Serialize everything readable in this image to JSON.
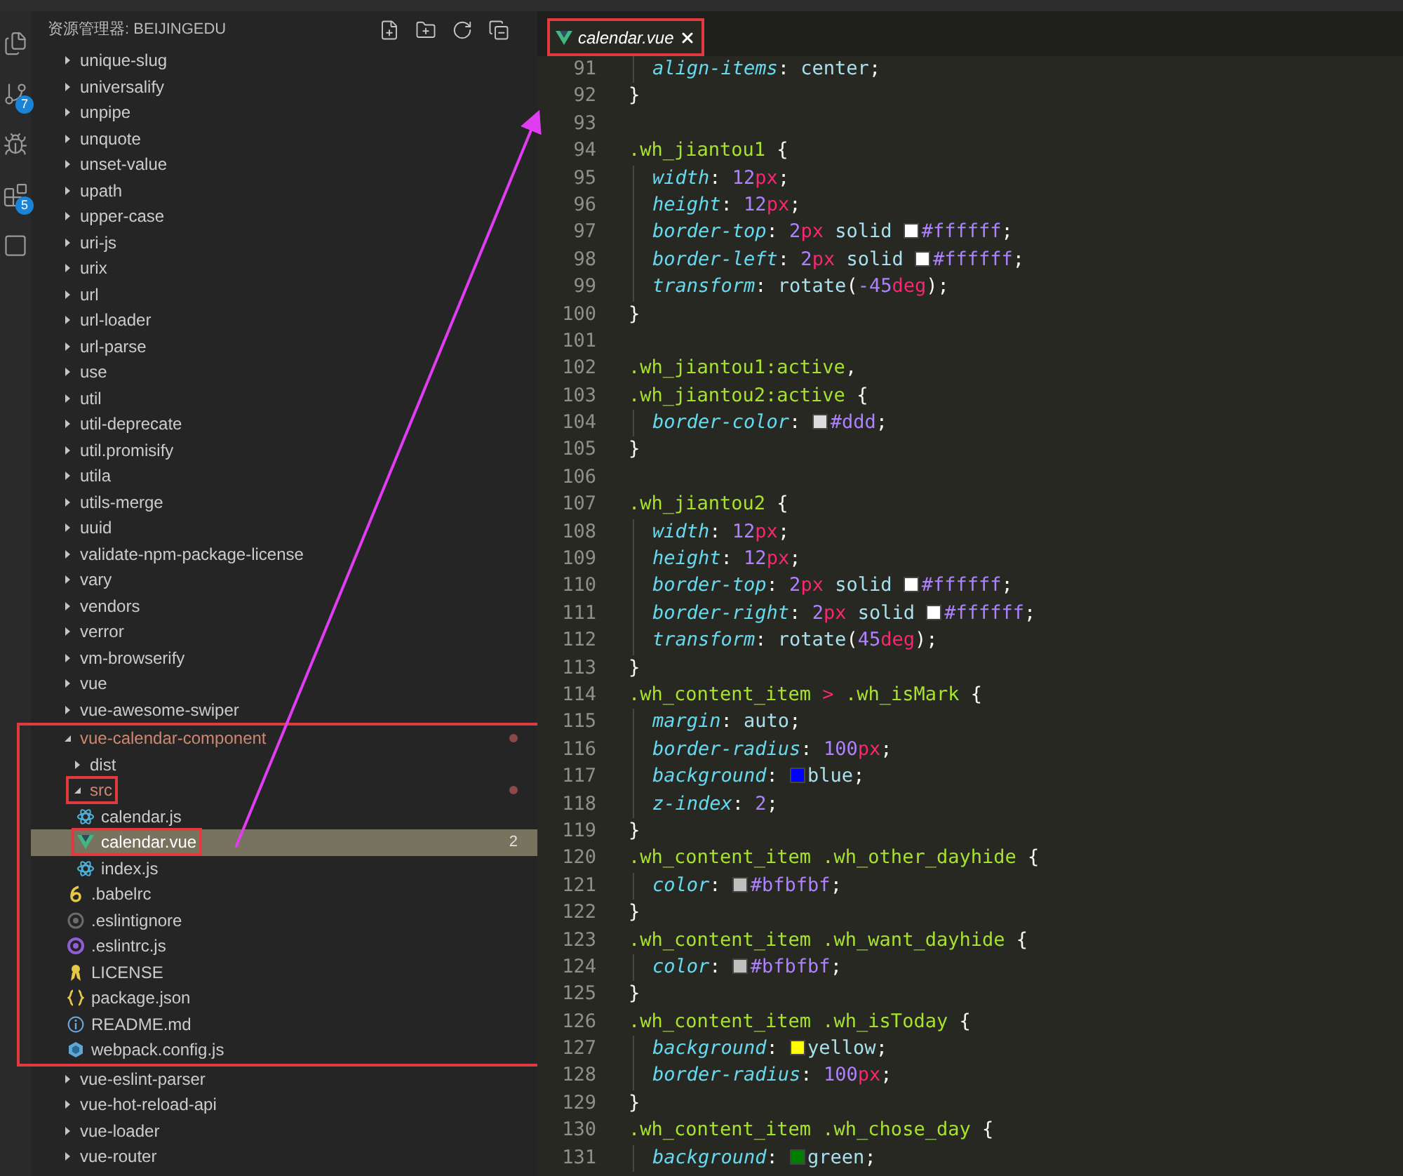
{
  "activity_bar": {
    "items": [
      {
        "kind": "files"
      },
      {
        "kind": "git",
        "badge": "7"
      },
      {
        "kind": "debug"
      },
      {
        "kind": "extensions",
        "badge": "5"
      },
      {
        "kind": "box"
      }
    ]
  },
  "sidebar": {
    "title": "资源管理器: BEIJINGEDU",
    "items": [
      {
        "label": "unique-slug",
        "kind": "folder",
        "expanded": false,
        "selected": false,
        "modified": false
      },
      {
        "label": "universalify",
        "kind": "folder",
        "expanded": false,
        "selected": false,
        "modified": false
      },
      {
        "label": "unpipe",
        "kind": "folder",
        "expanded": false,
        "selected": false,
        "modified": false
      },
      {
        "label": "unquote",
        "kind": "folder",
        "expanded": false,
        "selected": false,
        "modified": false
      },
      {
        "label": "unset-value",
        "kind": "folder",
        "expanded": false,
        "selected": false,
        "modified": false
      },
      {
        "label": "upath",
        "kind": "folder",
        "expanded": false,
        "selected": false,
        "modified": false
      },
      {
        "label": "upper-case",
        "kind": "folder",
        "expanded": false,
        "selected": false,
        "modified": false
      },
      {
        "label": "uri-js",
        "kind": "folder",
        "expanded": false,
        "selected": false,
        "modified": false
      },
      {
        "label": "urix",
        "kind": "folder",
        "expanded": false,
        "selected": false,
        "modified": false
      },
      {
        "label": "url",
        "kind": "folder",
        "expanded": false,
        "selected": false,
        "modified": false
      },
      {
        "label": "url-loader",
        "kind": "folder",
        "expanded": false,
        "selected": false,
        "modified": false
      },
      {
        "label": "url-parse",
        "kind": "folder",
        "expanded": false,
        "selected": false,
        "modified": false
      },
      {
        "label": "use",
        "kind": "folder",
        "expanded": false,
        "selected": false,
        "modified": false
      },
      {
        "label": "util",
        "kind": "folder",
        "expanded": false,
        "selected": false,
        "modified": false
      },
      {
        "label": "util-deprecate",
        "kind": "folder",
        "expanded": false,
        "selected": false,
        "modified": false
      },
      {
        "label": "util.promisify",
        "kind": "folder",
        "expanded": false,
        "selected": false,
        "modified": false
      },
      {
        "label": "utila",
        "kind": "folder",
        "expanded": false,
        "selected": false,
        "modified": false
      },
      {
        "label": "utils-merge",
        "kind": "folder",
        "expanded": false,
        "selected": false,
        "modified": false
      },
      {
        "label": "uuid",
        "kind": "folder",
        "expanded": false,
        "selected": false,
        "modified": false
      },
      {
        "label": "validate-npm-package-license",
        "kind": "folder",
        "expanded": false,
        "selected": false,
        "modified": false
      },
      {
        "label": "vary",
        "kind": "folder",
        "expanded": false,
        "selected": false,
        "modified": false
      },
      {
        "label": "vendors",
        "kind": "folder",
        "expanded": false,
        "selected": false,
        "modified": false
      },
      {
        "label": "verror",
        "kind": "folder",
        "expanded": false,
        "selected": false,
        "modified": false
      },
      {
        "label": "vm-browserify",
        "kind": "folder",
        "expanded": false,
        "selected": false,
        "modified": false
      },
      {
        "label": "vue",
        "kind": "folder",
        "expanded": false,
        "selected": false,
        "modified": false
      },
      {
        "label": "vue-awesome-swiper",
        "kind": "folder",
        "expanded": false,
        "selected": false,
        "modified": false
      },
      {
        "label": "vue-calendar-component",
        "kind": "folder",
        "expanded": true,
        "selected": false,
        "modified": true,
        "group_highlighted": true,
        "children": [
          {
            "label": "dist",
            "kind": "folder",
            "expanded": false,
            "selected": false,
            "modified": false
          },
          {
            "label": "src",
            "kind": "folder",
            "expanded": true,
            "selected": false,
            "modified": true,
            "highlighted": true,
            "children": [
              {
                "label": "calendar.js",
                "kind": "react",
                "selected": false,
                "modified": false
              },
              {
                "label": "calendar.vue",
                "kind": "vue",
                "selected": true,
                "modified": false,
                "highlighted": true,
                "badge": "2"
              },
              {
                "label": "index.js",
                "kind": "react",
                "selected": false,
                "modified": false
              }
            ]
          },
          {
            "label": ".babelrc",
            "kind": "babel",
            "selected": false,
            "modified": false
          },
          {
            "label": ".eslintignore",
            "kind": "ignore",
            "selected": false,
            "modified": false
          },
          {
            "label": ".eslintrc.js",
            "kind": "eslint",
            "selected": false,
            "modified": false
          },
          {
            "label": "LICENSE",
            "kind": "license",
            "selected": false,
            "modified": false
          },
          {
            "label": "package.json",
            "kind": "json",
            "selected": false,
            "modified": false
          },
          {
            "label": "README.md",
            "kind": "info",
            "selected": false,
            "modified": false
          },
          {
            "label": "webpack.config.js",
            "kind": "webpack",
            "selected": false,
            "modified": false
          }
        ]
      },
      {
        "label": "vue-eslint-parser",
        "kind": "folder",
        "expanded": false,
        "selected": false,
        "modified": false
      },
      {
        "label": "vue-hot-reload-api",
        "kind": "folder",
        "expanded": false,
        "selected": false,
        "modified": false
      },
      {
        "label": "vue-loader",
        "kind": "folder",
        "expanded": false,
        "selected": false,
        "modified": false
      },
      {
        "label": "vue-router",
        "kind": "folder",
        "expanded": false,
        "selected": false,
        "modified": false
      }
    ]
  },
  "tabs": [
    {
      "label": "calendar.vue",
      "kind": "vue",
      "selected": true,
      "highlighted": true
    }
  ],
  "editor": {
    "lines": [
      {
        "number": "91",
        "indented": true,
        "tokens": [
          {
            "kind": "prop",
            "text": "align-items"
          },
          {
            "kind": "punct",
            "text": ": "
          },
          {
            "kind": "val",
            "text": "center"
          },
          {
            "kind": "punct",
            "text": ";"
          }
        ]
      },
      {
        "number": "92",
        "indented": false,
        "tokens": [
          {
            "kind": "punct",
            "text": "}"
          }
        ]
      },
      {
        "number": "93",
        "indented": false
      },
      {
        "number": "94",
        "indented": false,
        "tokens": [
          {
            "kind": "sel",
            "text": ".wh_jiantou1"
          },
          {
            "kind": "punct",
            "text": " {"
          }
        ]
      },
      {
        "number": "95",
        "indented": true,
        "tokens": [
          {
            "kind": "prop",
            "text": "width"
          },
          {
            "kind": "punct",
            "text": ": "
          },
          {
            "kind": "num",
            "text": "12"
          },
          {
            "kind": "unit",
            "text": "px"
          },
          {
            "kind": "punct",
            "text": ";"
          }
        ]
      },
      {
        "number": "96",
        "indented": true,
        "tokens": [
          {
            "kind": "prop",
            "text": "height"
          },
          {
            "kind": "punct",
            "text": ": "
          },
          {
            "kind": "num",
            "text": "12"
          },
          {
            "kind": "unit",
            "text": "px"
          },
          {
            "kind": "punct",
            "text": ";"
          }
        ]
      },
      {
        "number": "97",
        "indented": true,
        "tokens": [
          {
            "kind": "prop",
            "text": "border-top"
          },
          {
            "kind": "punct",
            "text": ": "
          },
          {
            "kind": "num",
            "text": "2"
          },
          {
            "kind": "unit",
            "text": "px"
          },
          {
            "kind": "val",
            "text": " solid "
          },
          {
            "kind": "swatch",
            "color": "#ffffff"
          },
          {
            "kind": "hex",
            "text": "#ffffff"
          },
          {
            "kind": "punct",
            "text": ";"
          }
        ]
      },
      {
        "number": "98",
        "indented": true,
        "tokens": [
          {
            "kind": "prop",
            "text": "border-left"
          },
          {
            "kind": "punct",
            "text": ": "
          },
          {
            "kind": "num",
            "text": "2"
          },
          {
            "kind": "unit",
            "text": "px"
          },
          {
            "kind": "val",
            "text": " solid "
          },
          {
            "kind": "swatch",
            "color": "#ffffff"
          },
          {
            "kind": "hex",
            "text": "#ffffff"
          },
          {
            "kind": "punct",
            "text": ";"
          }
        ]
      },
      {
        "number": "99",
        "indented": true,
        "tokens": [
          {
            "kind": "prop",
            "text": "transform"
          },
          {
            "kind": "punct",
            "text": ": "
          },
          {
            "kind": "val",
            "text": "rotate"
          },
          {
            "kind": "punct",
            "text": "("
          },
          {
            "kind": "num",
            "text": "-45"
          },
          {
            "kind": "unit",
            "text": "deg"
          },
          {
            "kind": "punct",
            "text": ");"
          }
        ]
      },
      {
        "number": "100",
        "indented": false,
        "tokens": [
          {
            "kind": "punct",
            "text": "}"
          }
        ]
      },
      {
        "number": "101",
        "indented": false
      },
      {
        "number": "102",
        "indented": false,
        "tokens": [
          {
            "kind": "sel",
            "text": ".wh_jiantou1:active"
          },
          {
            "kind": "punct",
            "text": ","
          }
        ]
      },
      {
        "number": "103",
        "indented": false,
        "tokens": [
          {
            "kind": "sel",
            "text": ".wh_jiantou2:active"
          },
          {
            "kind": "punct",
            "text": " {"
          }
        ]
      },
      {
        "number": "104",
        "indented": true,
        "tokens": [
          {
            "kind": "prop",
            "text": "border-color"
          },
          {
            "kind": "punct",
            "text": ": "
          },
          {
            "kind": "swatch",
            "color": "#dddddd"
          },
          {
            "kind": "hex",
            "text": "#ddd"
          },
          {
            "kind": "punct",
            "text": ";"
          }
        ]
      },
      {
        "number": "105",
        "indented": false,
        "tokens": [
          {
            "kind": "punct",
            "text": "}"
          }
        ]
      },
      {
        "number": "106",
        "indented": false
      },
      {
        "number": "107",
        "indented": false,
        "tokens": [
          {
            "kind": "sel",
            "text": ".wh_jiantou2"
          },
          {
            "kind": "punct",
            "text": " {"
          }
        ]
      },
      {
        "number": "108",
        "indented": true,
        "tokens": [
          {
            "kind": "prop",
            "text": "width"
          },
          {
            "kind": "punct",
            "text": ": "
          },
          {
            "kind": "num",
            "text": "12"
          },
          {
            "kind": "unit",
            "text": "px"
          },
          {
            "kind": "punct",
            "text": ";"
          }
        ]
      },
      {
        "number": "109",
        "indented": true,
        "tokens": [
          {
            "kind": "prop",
            "text": "height"
          },
          {
            "kind": "punct",
            "text": ": "
          },
          {
            "kind": "num",
            "text": "12"
          },
          {
            "kind": "unit",
            "text": "px"
          },
          {
            "kind": "punct",
            "text": ";"
          }
        ]
      },
      {
        "number": "110",
        "indented": true,
        "tokens": [
          {
            "kind": "prop",
            "text": "border-top"
          },
          {
            "kind": "punct",
            "text": ": "
          },
          {
            "kind": "num",
            "text": "2"
          },
          {
            "kind": "unit",
            "text": "px"
          },
          {
            "kind": "val",
            "text": " solid "
          },
          {
            "kind": "swatch",
            "color": "#ffffff"
          },
          {
            "kind": "hex",
            "text": "#ffffff"
          },
          {
            "kind": "punct",
            "text": ";"
          }
        ]
      },
      {
        "number": "111",
        "indented": true,
        "tokens": [
          {
            "kind": "prop",
            "text": "border-right"
          },
          {
            "kind": "punct",
            "text": ": "
          },
          {
            "kind": "num",
            "text": "2"
          },
          {
            "kind": "unit",
            "text": "px"
          },
          {
            "kind": "val",
            "text": " solid "
          },
          {
            "kind": "swatch",
            "color": "#ffffff"
          },
          {
            "kind": "hex",
            "text": "#ffffff"
          },
          {
            "kind": "punct",
            "text": ";"
          }
        ]
      },
      {
        "number": "112",
        "indented": true,
        "tokens": [
          {
            "kind": "prop",
            "text": "transform"
          },
          {
            "kind": "punct",
            "text": ": "
          },
          {
            "kind": "val",
            "text": "rotate"
          },
          {
            "kind": "punct",
            "text": "("
          },
          {
            "kind": "num",
            "text": "45"
          },
          {
            "kind": "unit",
            "text": "deg"
          },
          {
            "kind": "punct",
            "text": ");"
          }
        ]
      },
      {
        "number": "113",
        "indented": false,
        "tokens": [
          {
            "kind": "punct",
            "text": "}"
          }
        ]
      },
      {
        "number": "114",
        "indented": false,
        "tokens": [
          {
            "kind": "sel",
            "text": ".wh_content_item "
          },
          {
            "kind": "unit",
            "text": ">"
          },
          {
            "kind": "sel",
            "text": " .wh_isMark"
          },
          {
            "kind": "punct",
            "text": " {"
          }
        ]
      },
      {
        "number": "115",
        "indented": true,
        "tokens": [
          {
            "kind": "prop",
            "text": "margin"
          },
          {
            "kind": "punct",
            "text": ": "
          },
          {
            "kind": "val",
            "text": "auto"
          },
          {
            "kind": "punct",
            "text": ";"
          }
        ]
      },
      {
        "number": "116",
        "indented": true,
        "tokens": [
          {
            "kind": "prop",
            "text": "border-radius"
          },
          {
            "kind": "punct",
            "text": ": "
          },
          {
            "kind": "num",
            "text": "100"
          },
          {
            "kind": "unit",
            "text": "px"
          },
          {
            "kind": "punct",
            "text": ";"
          }
        ]
      },
      {
        "number": "117",
        "indented": true,
        "tokens": [
          {
            "kind": "prop",
            "text": "background"
          },
          {
            "kind": "punct",
            "text": ": "
          },
          {
            "kind": "swatch",
            "color": "#0000ff"
          },
          {
            "kind": "val",
            "text": "blue"
          },
          {
            "kind": "punct",
            "text": ";"
          }
        ]
      },
      {
        "number": "118",
        "indented": true,
        "tokens": [
          {
            "kind": "prop",
            "text": "z-index"
          },
          {
            "kind": "punct",
            "text": ": "
          },
          {
            "kind": "num",
            "text": "2"
          },
          {
            "kind": "punct",
            "text": ";"
          }
        ]
      },
      {
        "number": "119",
        "indented": false,
        "tokens": [
          {
            "kind": "punct",
            "text": "}"
          }
        ]
      },
      {
        "number": "120",
        "indented": false,
        "tokens": [
          {
            "kind": "sel",
            "text": ".wh_content_item .wh_other_dayhide"
          },
          {
            "kind": "punct",
            "text": " {"
          }
        ]
      },
      {
        "number": "121",
        "indented": true,
        "tokens": [
          {
            "kind": "prop",
            "text": "color"
          },
          {
            "kind": "punct",
            "text": ": "
          },
          {
            "kind": "swatch",
            "color": "#bfbfbf"
          },
          {
            "kind": "hex",
            "text": "#bfbfbf"
          },
          {
            "kind": "punct",
            "text": ";"
          }
        ]
      },
      {
        "number": "122",
        "indented": false,
        "tokens": [
          {
            "kind": "punct",
            "text": "}"
          }
        ]
      },
      {
        "number": "123",
        "indented": false,
        "tokens": [
          {
            "kind": "sel",
            "text": ".wh_content_item .wh_want_dayhide"
          },
          {
            "kind": "punct",
            "text": " {"
          }
        ]
      },
      {
        "number": "124",
        "indented": true,
        "tokens": [
          {
            "kind": "prop",
            "text": "color"
          },
          {
            "kind": "punct",
            "text": ": "
          },
          {
            "kind": "swatch",
            "color": "#bfbfbf"
          },
          {
            "kind": "hex",
            "text": "#bfbfbf"
          },
          {
            "kind": "punct",
            "text": ";"
          }
        ]
      },
      {
        "number": "125",
        "indented": false,
        "tokens": [
          {
            "kind": "punct",
            "text": "}"
          }
        ]
      },
      {
        "number": "126",
        "indented": false,
        "tokens": [
          {
            "kind": "sel",
            "text": ".wh_content_item .wh_isToday"
          },
          {
            "kind": "punct",
            "text": " {"
          }
        ]
      },
      {
        "number": "127",
        "indented": true,
        "tokens": [
          {
            "kind": "prop",
            "text": "background"
          },
          {
            "kind": "punct",
            "text": ": "
          },
          {
            "kind": "swatch",
            "color": "#ffff00"
          },
          {
            "kind": "val",
            "text": "yellow"
          },
          {
            "kind": "punct",
            "text": ";"
          }
        ]
      },
      {
        "number": "128",
        "indented": true,
        "tokens": [
          {
            "kind": "prop",
            "text": "border-radius"
          },
          {
            "kind": "punct",
            "text": ": "
          },
          {
            "kind": "num",
            "text": "100"
          },
          {
            "kind": "unit",
            "text": "px"
          },
          {
            "kind": "punct",
            "text": ";"
          }
        ]
      },
      {
        "number": "129",
        "indented": false,
        "tokens": [
          {
            "kind": "punct",
            "text": "}"
          }
        ]
      },
      {
        "number": "130",
        "indented": false,
        "tokens": [
          {
            "kind": "sel",
            "text": ".wh_content_item .wh_chose_day"
          },
          {
            "kind": "punct",
            "text": " {"
          }
        ]
      },
      {
        "number": "131",
        "indented": true,
        "tokens": [
          {
            "kind": "prop",
            "text": "background"
          },
          {
            "kind": "punct",
            "text": ": "
          },
          {
            "kind": "swatch",
            "color": "#008000"
          },
          {
            "kind": "val",
            "text": "green"
          },
          {
            "kind": "punct",
            "text": ";"
          }
        ]
      }
    ]
  }
}
